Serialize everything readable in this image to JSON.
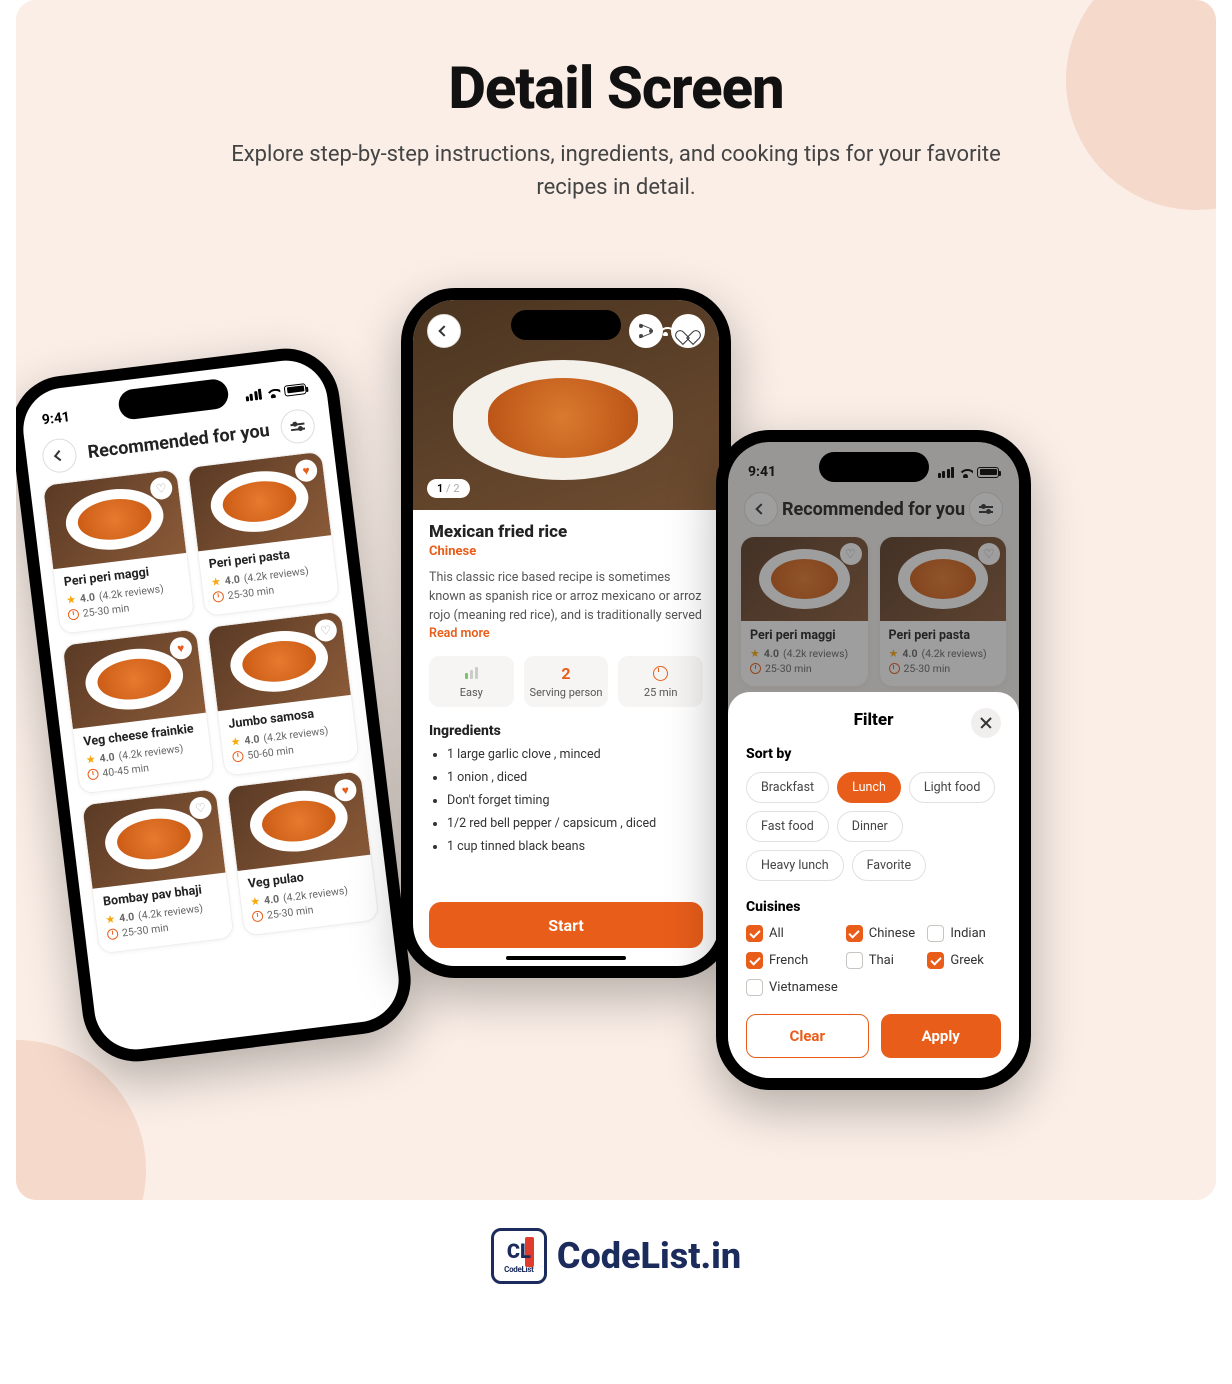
{
  "colors": {
    "accent": "#e85d1a",
    "bg": "#faeee7",
    "navy": "#1a2b5c"
  },
  "hero": {
    "title": "Detail Screen",
    "subtitle": "Explore step-by-step instructions, ingredients, and cooking tips for your favorite recipes in detail."
  },
  "statusbar": {
    "time": "9:41"
  },
  "phone_list": {
    "header": "Recommended for you",
    "cards": [
      {
        "title": "Peri peri maggi",
        "rating": "4.0",
        "reviews": "(4.2k reviews)",
        "time": "25-30 min",
        "fav": false
      },
      {
        "title": "Peri peri pasta",
        "rating": "4.0",
        "reviews": "(4.2k reviews)",
        "time": "25-30 min",
        "fav": true
      },
      {
        "title": "Veg cheese frainkie",
        "rating": "4.0",
        "reviews": "(4.2k reviews)",
        "time": "40-45 min",
        "fav": true
      },
      {
        "title": "Jumbo samosa",
        "rating": "4.0",
        "reviews": "(4.2k reviews)",
        "time": "50-60 min",
        "fav": false
      },
      {
        "title": "Bombay pav bhaji",
        "rating": "4.0",
        "reviews": "(4.2k reviews)",
        "time": "25-30 min",
        "fav": false
      },
      {
        "title": "Veg pulao",
        "rating": "4.0",
        "reviews": "(4.2k reviews)",
        "time": "25-30 min",
        "fav": true
      }
    ]
  },
  "phone_detail": {
    "pager_current": "1",
    "pager_total": "2",
    "title": "Mexican fried rice",
    "cuisine_tag": "Chinese",
    "desc_pre": "This classic rice based recipe is sometimes known as spanish rice or arroz mexicano or arroz rojo (meaning red rice), and is traditionally served ",
    "read_more": "Read more",
    "stat_difficulty": "Easy",
    "stat_serving_value": "2",
    "stat_serving_label": "Serving person",
    "stat_time": "25 min",
    "ingredients_label": "Ingredients",
    "ingredients": [
      "1 large garlic clove , minced",
      "1 onion , diced",
      "Don't forget timing",
      "1/2 red bell pepper / capsicum , diced",
      "1 cup tinned black beans"
    ],
    "start_label": "Start"
  },
  "phone_filter": {
    "header": "Recommended for you",
    "visible_cards": [
      {
        "title": "Peri peri maggi",
        "rating": "4.0",
        "reviews": "(4.2k reviews)",
        "time": "25-30 min"
      },
      {
        "title": "Peri peri pasta",
        "rating": "4.0",
        "reviews": "(4.2k reviews)",
        "time": "25-30 min"
      }
    ],
    "sheet": {
      "title": "Filter",
      "sort_label": "Sort by",
      "sort_chips": [
        {
          "label": "Brackfast",
          "on": false
        },
        {
          "label": "Lunch",
          "on": true
        },
        {
          "label": "Light food",
          "on": false
        },
        {
          "label": "Fast food",
          "on": false
        },
        {
          "label": "Dinner",
          "on": false
        },
        {
          "label": "Heavy lunch",
          "on": false
        },
        {
          "label": "Favorite",
          "on": false
        }
      ],
      "cuisines_label": "Cuisines",
      "cuisines": [
        {
          "label": "All",
          "on": true
        },
        {
          "label": "Chinese",
          "on": true
        },
        {
          "label": "Indian",
          "on": false
        },
        {
          "label": "French",
          "on": true
        },
        {
          "label": "Thai",
          "on": false
        },
        {
          "label": "Greek",
          "on": true
        },
        {
          "label": "Vietnamese",
          "on": false
        }
      ],
      "clear_label": "Clear",
      "apply_label": "Apply"
    }
  },
  "footer": {
    "brand": "CodeList.in",
    "badge_sub": "CodeList"
  }
}
